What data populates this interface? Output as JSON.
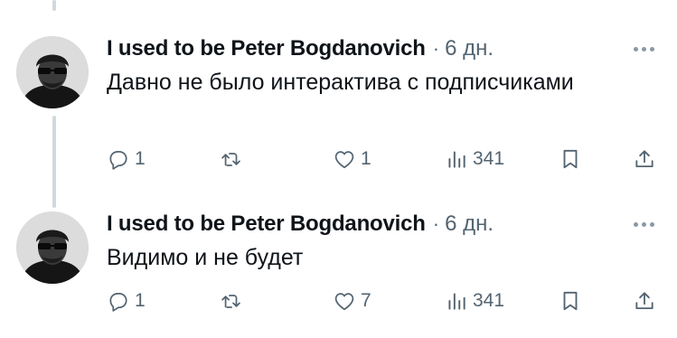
{
  "thread": [
    {
      "author": "I used to be Peter Bogdanovich",
      "separator": "·",
      "time": "6 дн.",
      "text": "Давно не было интерактива с подписчиками",
      "replies": "1",
      "reposts": "",
      "likes": "1",
      "views": "341"
    },
    {
      "author": "I used to be Peter Bogdanovich",
      "separator": "·",
      "time": "6 дн.",
      "text": "Видимо и не будет",
      "replies": "1",
      "reposts": "",
      "likes": "7",
      "views": "341"
    }
  ],
  "icons": {
    "more": "more-dots-icon",
    "reply": "reply-bubble-icon",
    "repost": "repost-arrows-icon",
    "like": "heart-icon",
    "views": "views-bars-icon",
    "bookmark": "bookmark-icon",
    "share": "share-upload-icon"
  },
  "colors": {
    "text": "#0f1419",
    "secondary": "#536471",
    "thread_line": "#cfd9de"
  }
}
